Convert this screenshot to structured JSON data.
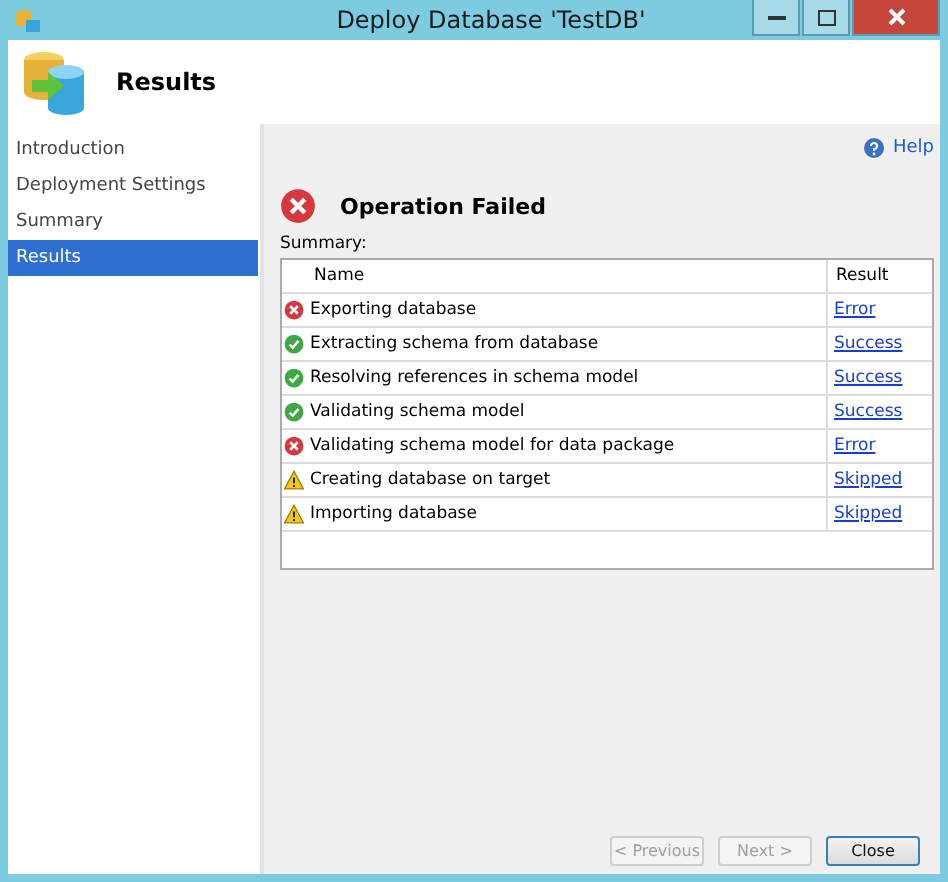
{
  "window": {
    "title": "Deploy Database 'TestDB'"
  },
  "header": {
    "title": "Results"
  },
  "sidebar": {
    "items": [
      {
        "label": "Introduction",
        "selected": false
      },
      {
        "label": "Deployment Settings",
        "selected": false
      },
      {
        "label": "Summary",
        "selected": false
      },
      {
        "label": "Results",
        "selected": true
      }
    ]
  },
  "help": {
    "label": "Help"
  },
  "status": {
    "kind": "error",
    "title": "Operation Failed"
  },
  "summary": {
    "label": "Summary:",
    "columns": [
      "Name",
      "Result"
    ],
    "rows": [
      {
        "kind": "error",
        "name": "Exporting database",
        "result": "Error"
      },
      {
        "kind": "success",
        "name": "Extracting schema from database",
        "result": "Success"
      },
      {
        "kind": "success",
        "name": "Resolving references in schema model",
        "result": "Success"
      },
      {
        "kind": "success",
        "name": "Validating schema model",
        "result": "Success"
      },
      {
        "kind": "error",
        "name": "Validating schema model for data package",
        "result": "Error"
      },
      {
        "kind": "warning",
        "name": "Creating database on target",
        "result": "Skipped"
      },
      {
        "kind": "warning",
        "name": "Importing database",
        "result": "Skipped"
      }
    ]
  },
  "buttons": [
    {
      "label": "< Previous",
      "disabled": true
    },
    {
      "label": "Next >",
      "disabled": true
    },
    {
      "label": "Close",
      "disabled": false
    }
  ]
}
